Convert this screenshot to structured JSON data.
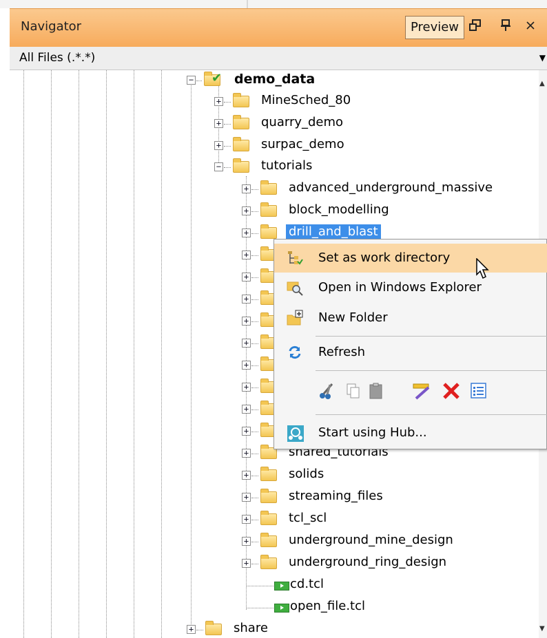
{
  "panel": {
    "title": "Navigator",
    "preview_label": "Preview",
    "filter_value": "All Files (.*.*)"
  },
  "tree": [
    {
      "label": "demo_data",
      "expanded": true
    },
    {
      "label": "MineSched_80"
    },
    {
      "label": "quarry_demo"
    },
    {
      "label": "surpac_demo"
    },
    {
      "label": "tutorials",
      "expanded": true
    },
    {
      "label": "advanced_underground_massive"
    },
    {
      "label": "block_modelling"
    },
    {
      "label": "drill_and_blast",
      "selected": true
    },
    {
      "label": "shared_tutorials"
    },
    {
      "label": "solids"
    },
    {
      "label": "streaming_files"
    },
    {
      "label": "tcl_scl"
    },
    {
      "label": "underground_mine_design"
    },
    {
      "label": "underground_ring_design"
    },
    {
      "label": "cd.tcl"
    },
    {
      "label": "open_file.tcl"
    },
    {
      "label": "share"
    }
  ],
  "context_menu": {
    "items": [
      {
        "label": "Set as work directory",
        "icon": "work-directory-icon",
        "highlighted": true
      },
      {
        "label": "Open in Windows Explorer",
        "icon": "explorer-search-icon"
      },
      {
        "label": "New Folder",
        "icon": "new-folder-icon"
      },
      {
        "label": "Refresh",
        "icon": "refresh-icon"
      },
      {
        "label": "Start using Hub...",
        "icon": "hub-icon"
      }
    ],
    "tools": [
      "cut-icon",
      "copy-icon",
      "paste-icon",
      "rename-icon",
      "delete-icon",
      "properties-icon"
    ]
  },
  "colors": {
    "title_bar": "#f9b96f",
    "selection": "#3d8ee9",
    "menu_hover": "#fbd8a6"
  }
}
